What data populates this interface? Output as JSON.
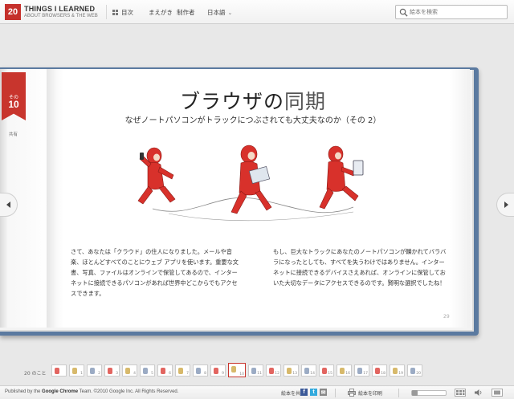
{
  "header": {
    "logo_badge": "20",
    "logo_line1": "THINGS I LEARNED",
    "logo_line2": "ABOUT BROWSERS & THE WEB",
    "nav": {
      "contents": "目次",
      "foreword": "まえがき",
      "credits": "制作者",
      "language": "日本語"
    },
    "search_placeholder": "絵本を検索"
  },
  "chapter": {
    "ribbon_label": "その",
    "ribbon_number": "10",
    "ribbon_note": "共有",
    "title_main": "ブラウザの",
    "title_light": "同期",
    "subtitle": "なぜノートパソコンがトラックにつぶされても大丈夫なのか（その 2）",
    "paragraph_left": "さて、あなたは「クラウド」の住人になりました。メールや音楽、ほとんどすべてのことにウェブ アプリを使います。重要な文書、写真、ファイルはオンラインで保管してあるので、インターネットに接続できるパソコンがあれば世界中どこからでもアクセスできます。",
    "paragraph_right": "もし、巨大なトラックにあなたのノートパソコンが轢かれてバラバラになったとしても、すべてを失うわけではありません。インターネットに接続できるデバイスさえあれば、オンラインに保管しておいた大切なデータにアクセスできるのです。賢明な選択でしたね！",
    "page_number": "29"
  },
  "thumbnails": {
    "label": "20 のこと",
    "items": [
      "",
      "1",
      "2",
      "3",
      "4",
      "5",
      "6",
      "7",
      "8",
      "9",
      "10",
      "11",
      "12",
      "13",
      "14",
      "15",
      "16",
      "17",
      "18",
      "19",
      "20"
    ],
    "active_index": 10
  },
  "footer": {
    "credit_prefix": "Published by the ",
    "credit_brand": "Google Chrome",
    "credit_suffix": " Team. ©2010 Google Inc. All Rights Reserved.",
    "share_label": "絵本を共有",
    "print_label": "絵本を印刷",
    "zoom_level": 0
  },
  "colors": {
    "accent_red": "#c8352d",
    "cover_blue": "#5b7aa0"
  }
}
